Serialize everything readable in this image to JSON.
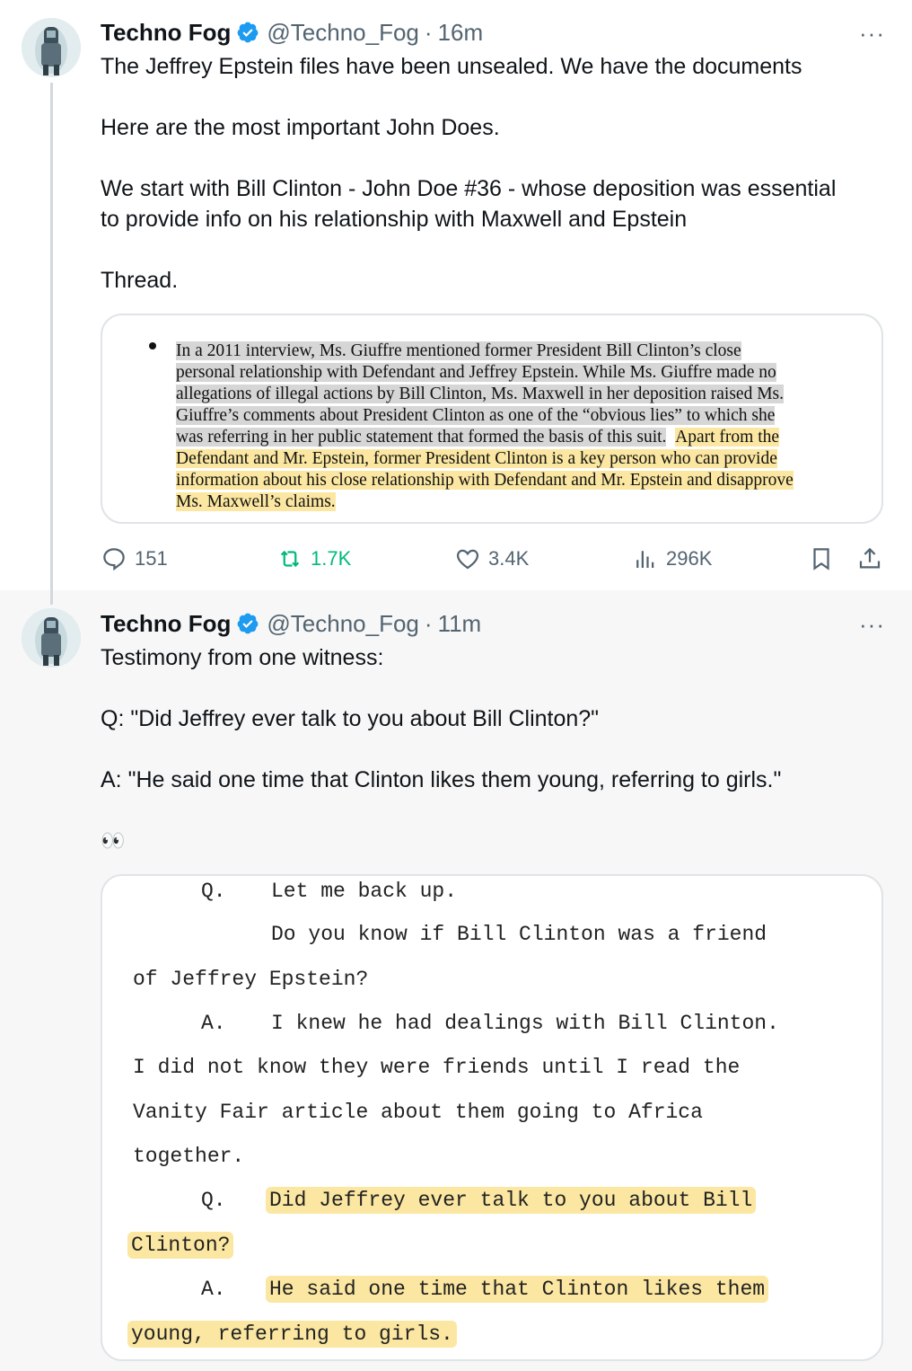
{
  "tweet1": {
    "display_name": "Techno Fog",
    "handle": "@Techno_Fog",
    "separator": "·",
    "time": "16m",
    "more": "···",
    "text": [
      "The Jeffrey Epstein files have been unsealed. We have the documents",
      "Here are the most important John Does.",
      "We start with Bill Clinton - John Doe #36 - whose deposition was essential",
      "to provide info on his relationship with Maxwell and Epstein",
      "Thread."
    ],
    "document_lines": [
      "In a 2011 interview, Ms. Giuffre mentioned former President Bill Clinton’s close",
      "personal relationship with Defendant and Jeffrey Epstein.  While Ms. Giuffre made no",
      "allegations of illegal actions by Bill Clinton, Ms. Maxwell in her deposition raised Ms.",
      "Giuffre’s comments about President Clinton as one of the “obvious lies” to which she",
      "was referring in her public statement that formed the basis of this suit.",
      "Apart from the",
      "Defendant and Mr. Epstein, former President Clinton is a key person who can provide",
      "information about his close relationship with Defendant and Mr. Epstein and disapprove",
      "Ms. Maxwell’s claims."
    ],
    "stats": {
      "replies": "151",
      "retweets": "1.7K",
      "likes": "3.4K",
      "views": "296K"
    },
    "colors": {
      "retweet": "#00ba7c",
      "verified": "#1d9bf0"
    }
  },
  "tweet2": {
    "display_name": "Techno Fog",
    "handle": "@Techno_Fog",
    "separator": "·",
    "time": "11m",
    "more": "···",
    "text": [
      "Testimony from one witness:",
      "Q: \"Did Jeffrey ever talk to you about Bill Clinton?\"",
      "A: \"He said one time that Clinton likes them young, referring to girls.\"",
      "👀"
    ],
    "transcript": {
      "q1_label": "Q.",
      "q1_text": "Let me back up.",
      "q1_cont1": "Do you know if Bill Clinton was a friend",
      "q1_cont2": "of Jeffrey Epstein?",
      "a1_label": "A.",
      "a1_text": "I knew he had dealings with Bill Clinton.",
      "a1_cont1": "I did not know they were friends until I read the",
      "a1_cont2": "Vanity Fair article about them going to Africa",
      "a1_cont3": "together.",
      "q2_label": "Q.",
      "q2_text": "Did Jeffrey ever talk to you about Bill",
      "q2_cont1": "Clinton?",
      "a2_label": "A.",
      "a2_text": "He said one time that Clinton likes them",
      "a2_cont1": "young, referring to girls."
    }
  }
}
